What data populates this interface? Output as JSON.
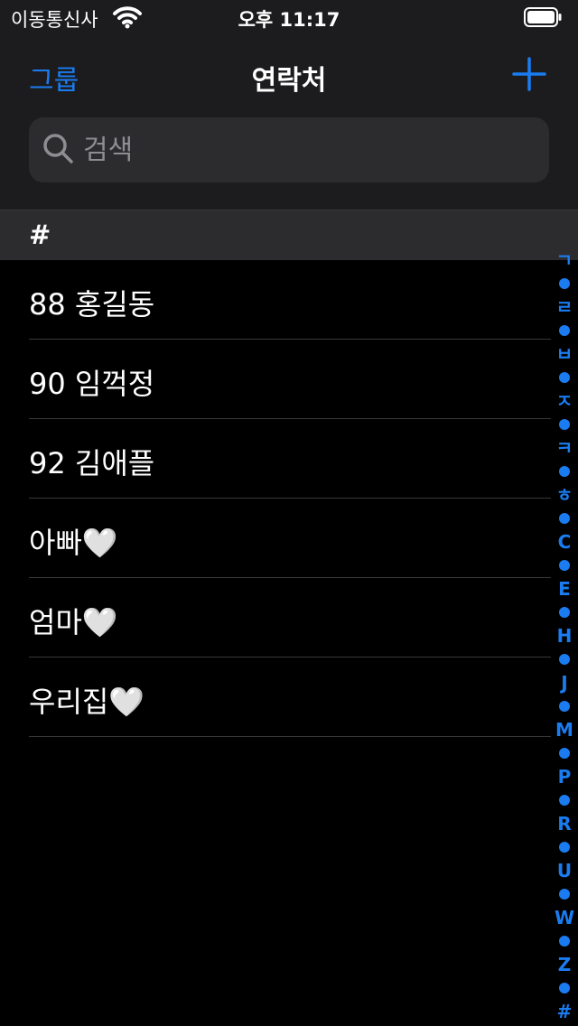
{
  "status_bar": {
    "carrier": "이동통신사",
    "time": "오후 11:17"
  },
  "nav": {
    "groups_label": "그룹",
    "title": "연락처",
    "add_icon": "plus-icon"
  },
  "search": {
    "placeholder": "검색",
    "value": "",
    "icon": "magnifier-icon"
  },
  "section": {
    "header": "#"
  },
  "contacts": [
    {
      "name": "88 홍길동"
    },
    {
      "name": "90 임꺽정"
    },
    {
      "name": "92 김애플"
    },
    {
      "name": "아빠🤍"
    },
    {
      "name": "엄마🤍"
    },
    {
      "name": "우리집🤍"
    }
  ],
  "index_letters": [
    "ㄱ",
    "ㄹ",
    "ㅂ",
    "ㅈ",
    "ㅋ",
    "ㅎ",
    "C",
    "E",
    "H",
    "J",
    "M",
    "P",
    "R",
    "U",
    "W",
    "Z",
    "#"
  ],
  "colors": {
    "accent": "#1a7cf0",
    "background": "#000000",
    "top_bar": "#1c1c1e",
    "search_field": "#2c2c2e",
    "separator": "#38383a"
  }
}
